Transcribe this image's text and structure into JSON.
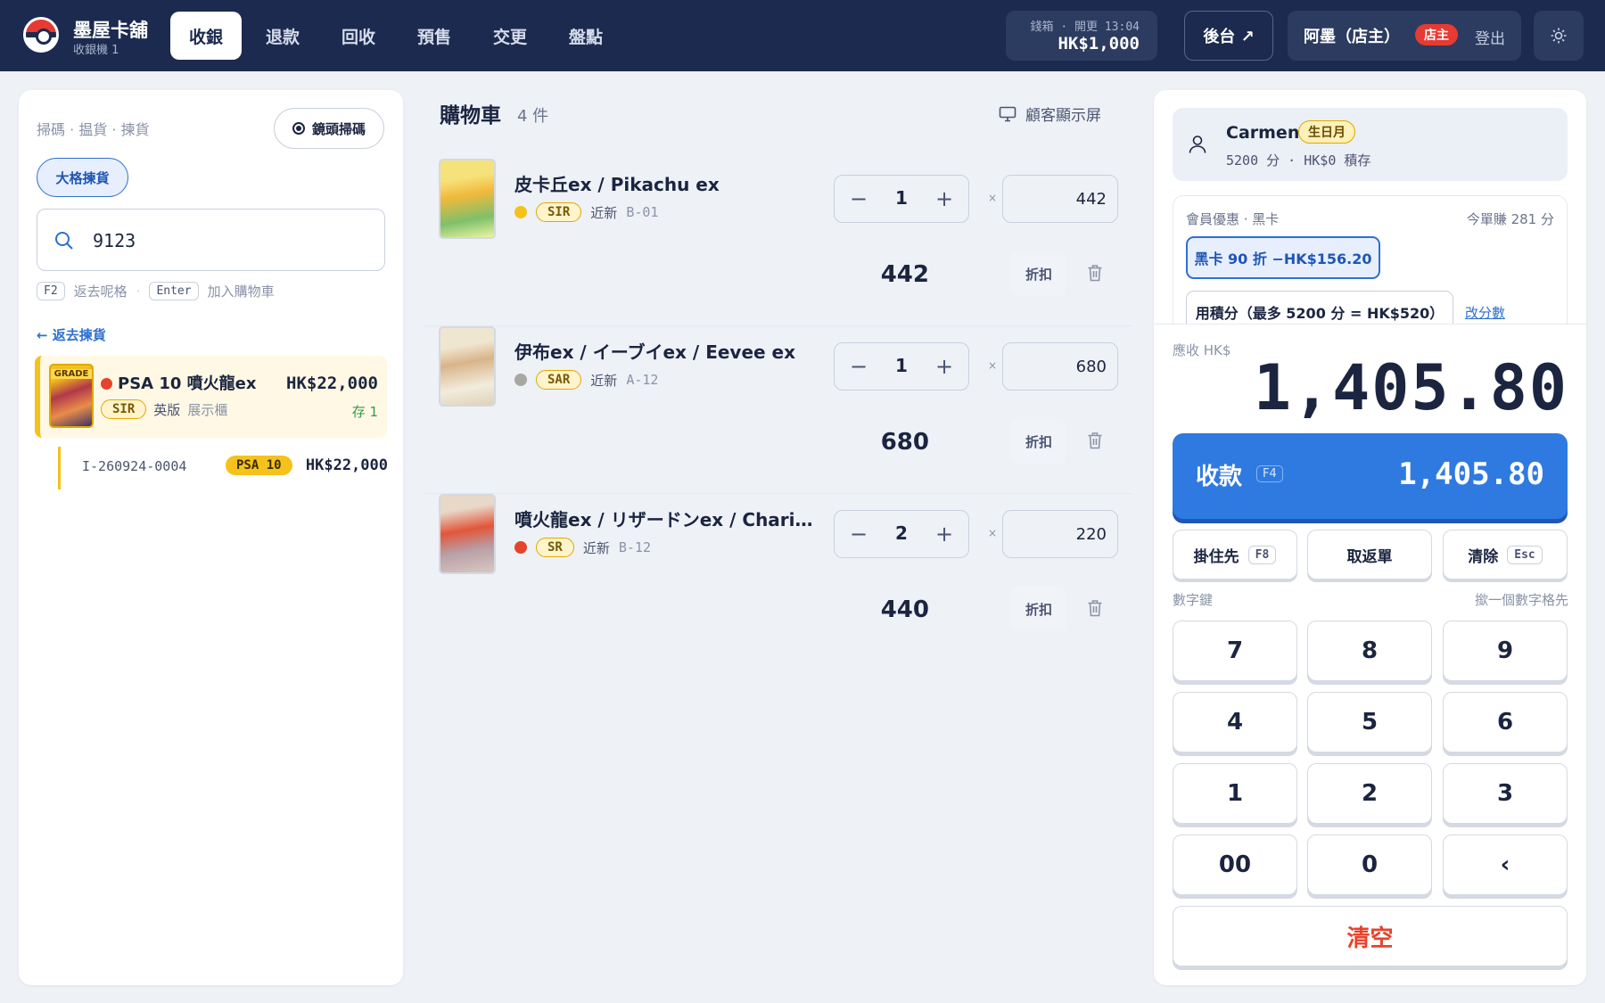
{
  "header": {
    "shop_name": "墨屋卡舖",
    "terminal": "收銀機 1",
    "tabs": [
      "收銀",
      "退款",
      "回收",
      "預售",
      "交更",
      "盤點"
    ],
    "active_tab": "收銀",
    "drawer_label": "錢箱 · 開更 13:04",
    "drawer_amount": "HK$1,000",
    "backoffice": "後台 ↗",
    "user_name": "阿墨（店主）",
    "user_role": "店主",
    "logout": "登出"
  },
  "left": {
    "modes": "掃碼 · 揾貨 · 揀貨",
    "camera_button": "鏡頭掃碼",
    "grade_button": "大格揀貨",
    "search_value": "9123",
    "hint_f2_key": "F2",
    "hint_f2_text": "返去呢格",
    "hint_enter_key": "Enter",
    "hint_enter_text": "加入購物車",
    "back_link": "← 返去揀貨",
    "result": {
      "grade_tag": "GRADE",
      "title": "PSA 10 噴火龍ex",
      "price": "HK$22,000",
      "rarity": "SIR",
      "lang": "英版",
      "location": "展示櫃",
      "stock": "存 1",
      "dot_color": "#e6432c"
    },
    "sub_item": {
      "id": "I-260924-0004",
      "grade": "PSA 10",
      "price": "HK$22,000"
    }
  },
  "cart": {
    "title": "購物車",
    "count": "4 件",
    "customer_display": "顧客顯示屏",
    "discount_label": "折扣",
    "times": "×",
    "items": [
      {
        "name": "皮卡丘ex / Pikachu ex",
        "dot_color": "#f4c21b",
        "rarity": "SIR",
        "condition": "近新",
        "location": "B-01",
        "qty": "1",
        "price": "442",
        "total": "442"
      },
      {
        "name": "伊布ex / イーブイex / Eevee ex",
        "dot_color": "#a8a8a0",
        "rarity": "SAR",
        "condition": "近新",
        "location": "A-12",
        "qty": "1",
        "price": "680",
        "total": "680"
      },
      {
        "name": "噴火龍ex / リザードンex / Charizard ex",
        "dot_color": "#e6432c",
        "rarity": "SR",
        "condition": "近新",
        "location": "B-12",
        "qty": "2",
        "price": "220",
        "total": "440"
      }
    ]
  },
  "checkout": {
    "member_name": "Carmen",
    "member_badge": "生日月",
    "member_points": "5200 分 · HK$0 積存",
    "promo_header": "會員優惠 · 黑卡",
    "promo_earn": "今單賺 281 分",
    "promo_active": "黑卡 90 折 −HK$156.20",
    "promo_points": "用積分（最多 5200 分 = HK$520）",
    "promo_edit": "改分數",
    "due_label": "應收 HK$",
    "due_amount": "1,405.80",
    "pay_label": "收款",
    "pay_key": "F4",
    "pay_amount": "1,405.80",
    "hold_label": "掛住先",
    "hold_key": "F8",
    "recall_label": "取返單",
    "clear_label": "清除",
    "clear_key": "Esc",
    "numpad_label": "數字鍵",
    "numpad_hint": "撳一個數字格先",
    "keys": [
      "7",
      "8",
      "9",
      "4",
      "5",
      "6",
      "1",
      "2",
      "3",
      "00",
      "0",
      "‹"
    ],
    "clear_all": "清空"
  }
}
